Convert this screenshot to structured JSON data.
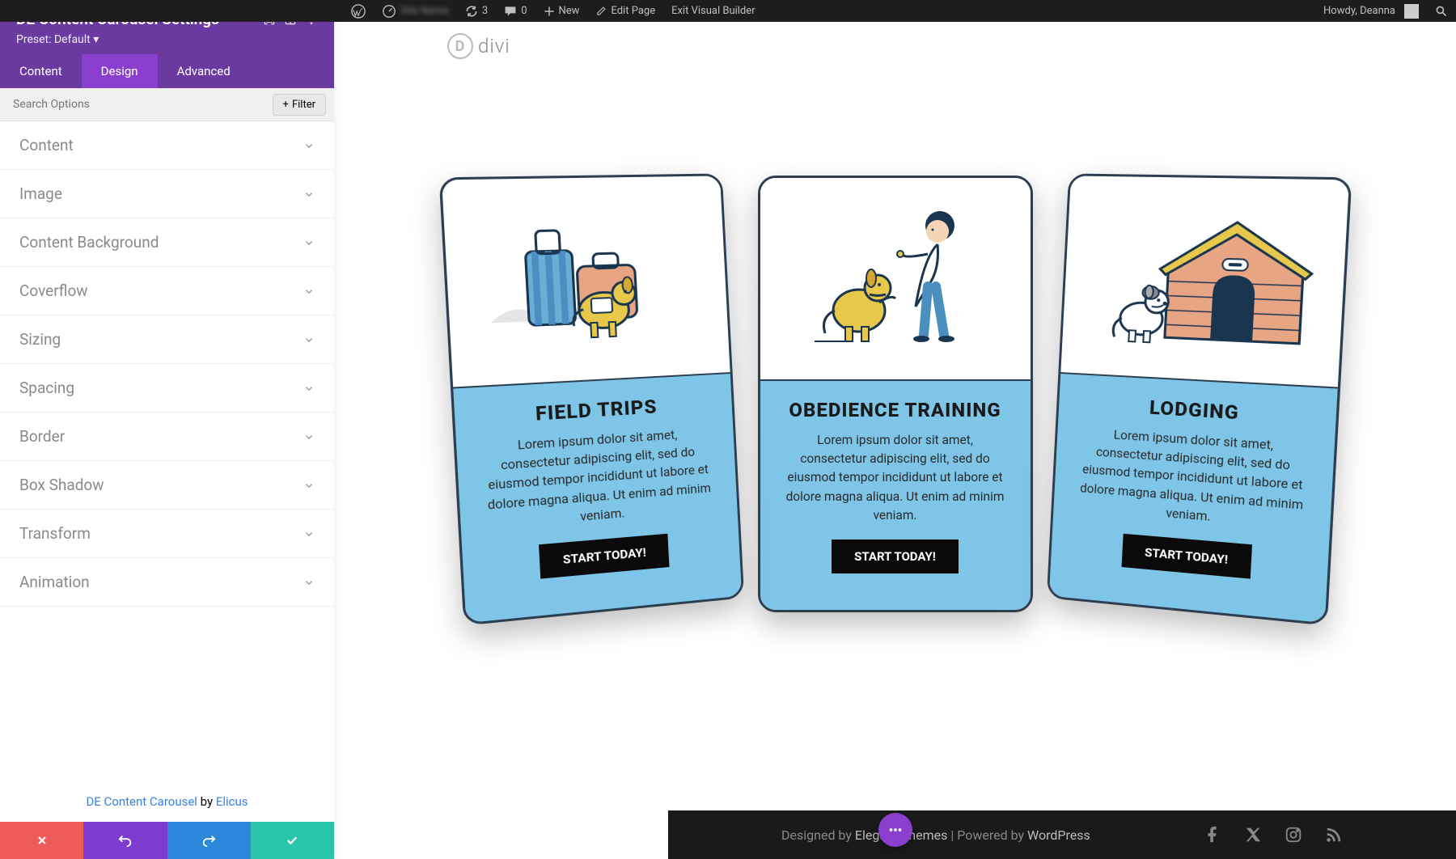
{
  "admin_bar": {
    "refresh_count": "3",
    "comments_count": "0",
    "new_label": "New",
    "edit_page_label": "Edit Page",
    "exit_builder_label": "Exit Visual Builder",
    "howdy_label": "Howdy, Deanna"
  },
  "settings": {
    "title": "DE Content Carousel Settings",
    "preset_label": "Preset: Default",
    "tabs": {
      "content": "Content",
      "design": "Design",
      "advanced": "Advanced"
    },
    "search_placeholder": "Search Options",
    "filter_label": "Filter",
    "groups": [
      "Content",
      "Image",
      "Content Background",
      "Coverflow",
      "Sizing",
      "Spacing",
      "Border",
      "Box Shadow",
      "Transform",
      "Animation"
    ],
    "credit_plugin": "DE Content Carousel",
    "credit_by": " by ",
    "credit_author": "Elicus"
  },
  "preview": {
    "logo_text": "divi",
    "cards": [
      {
        "title": "FIELD TRIPS",
        "desc": "Lorem ipsum dolor sit amet, consectetur adipiscing elit, sed do eiusmod tempor incididunt ut labore et dolore magna aliqua. Ut enim ad minim veniam.",
        "btn": "START TODAY!"
      },
      {
        "title": "OBEDIENCE TRAINING",
        "desc": "Lorem ipsum dolor sit amet, consectetur adipiscing elit, sed do eiusmod tempor incididunt ut labore et dolore magna aliqua. Ut enim ad minim veniam.",
        "btn": "START TODAY!"
      },
      {
        "title": "LODGING",
        "desc": "Lorem ipsum dolor sit amet, consectetur adipiscing elit, sed do eiusmod tempor incididunt ut labore et dolore magna aliqua. Ut enim ad minim veniam.",
        "btn": "START TODAY!"
      }
    ]
  },
  "footer": {
    "designed_by": "Designed by ",
    "theme": "Elegant Themes",
    "sep": " | Powered by ",
    "cms": "WordPress"
  }
}
